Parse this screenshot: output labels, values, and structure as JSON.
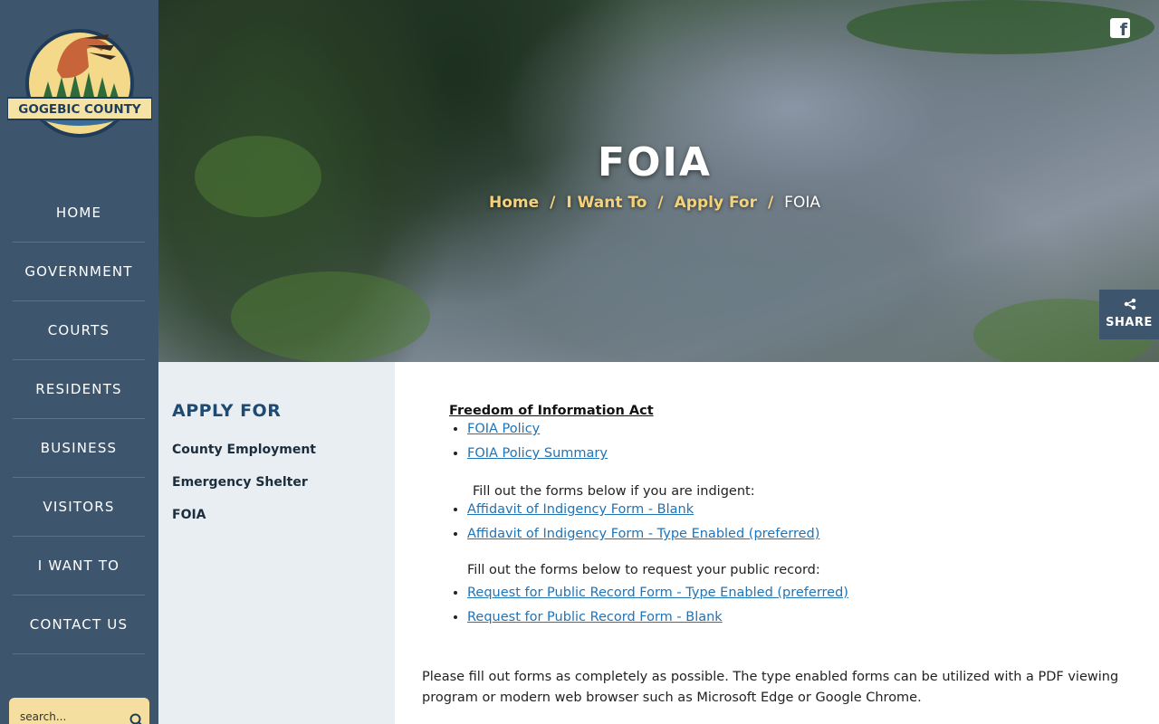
{
  "sidebar": {
    "logo_text": "GOGEBIC COUNTY",
    "nav": [
      {
        "label": "HOME"
      },
      {
        "label": "GOVERNMENT"
      },
      {
        "label": "COURTS"
      },
      {
        "label": "RESIDENTS"
      },
      {
        "label": "BUSINESS"
      },
      {
        "label": "VISITORS"
      },
      {
        "label": "I WANT TO"
      },
      {
        "label": "CONTACT US"
      }
    ],
    "search_placeholder": "search..."
  },
  "hero": {
    "title": "FOIA",
    "breadcrumb": {
      "home": "Home",
      "i_want_to": "I Want To",
      "apply_for": "Apply For",
      "current": "FOIA",
      "separator": "/"
    },
    "social_icon": "facebook-icon",
    "share_label": "SHARE"
  },
  "subnav": {
    "title": "APPLY FOR",
    "items": [
      {
        "label": "County Employment"
      },
      {
        "label": "Emergency Shelter"
      },
      {
        "label": "FOIA"
      }
    ]
  },
  "content": {
    "heading": "Freedom of Information Act",
    "policy_links": [
      {
        "label": "FOIA Policy"
      },
      {
        "label": "FOIA Policy Summary"
      }
    ],
    "indigent_note": "Fill out the forms below if you are indigent:",
    "indigent_links": [
      {
        "label": "Affidavit of Indigency Form - Blank"
      },
      {
        "label": "Affidavit of Indigency Form - Type Enabled (preferred)"
      }
    ],
    "record_note": "Fill out the forms below to request your public record:",
    "record_links": [
      {
        "label": "Request for Public Record Form - Type Enabled (preferred)"
      },
      {
        "label": "Request for Public Record Form - Blank"
      }
    ],
    "instructions": "Please fill out forms as completely as possible. The type enabled forms can be utilized with a PDF viewing program or modern web browser such as Microsoft Edge or Google Chrome."
  },
  "colors": {
    "sidebar_bg": "#3e566d",
    "accent_gold": "#f5d27a",
    "link_blue": "#1f73b7",
    "subnav_title": "#1f4a72"
  }
}
